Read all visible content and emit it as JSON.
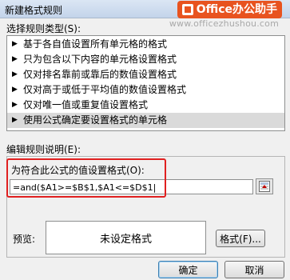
{
  "window": {
    "title": "新建格式规则"
  },
  "branding": {
    "logo_text": "Office办公助手",
    "watermark": "www.officezhushou.com"
  },
  "rule_type": {
    "label": "选择规则类型(S):",
    "items": [
      "基于各自值设置所有单元格的格式",
      "只为包含以下内容的单元格设置格式",
      "仅对排名靠前或靠后的数值设置格式",
      "仅对高于或低于平均值的数值设置格式",
      "仅对唯一值或重复值设置格式",
      "使用公式确定要设置格式的单元格"
    ],
    "selected_index": 5
  },
  "edit": {
    "label": "编辑规则说明(E):",
    "formula_label": "为符合此公式的值设置格式(O):",
    "formula_value": "=and($A1>=$B$1,$A1<=$D$1|"
  },
  "preview": {
    "label": "预览:",
    "text": "未设定格式",
    "format_button": "格式(F)..."
  },
  "footer": {
    "ok_button": "确定",
    "cancel_button": "取消"
  },
  "icons": {
    "list_marker": "triangle-right-icon",
    "collapse": "range-collapse-icon"
  },
  "colors": {
    "highlight": "#e02020",
    "logo_bg": "#e8531f"
  }
}
